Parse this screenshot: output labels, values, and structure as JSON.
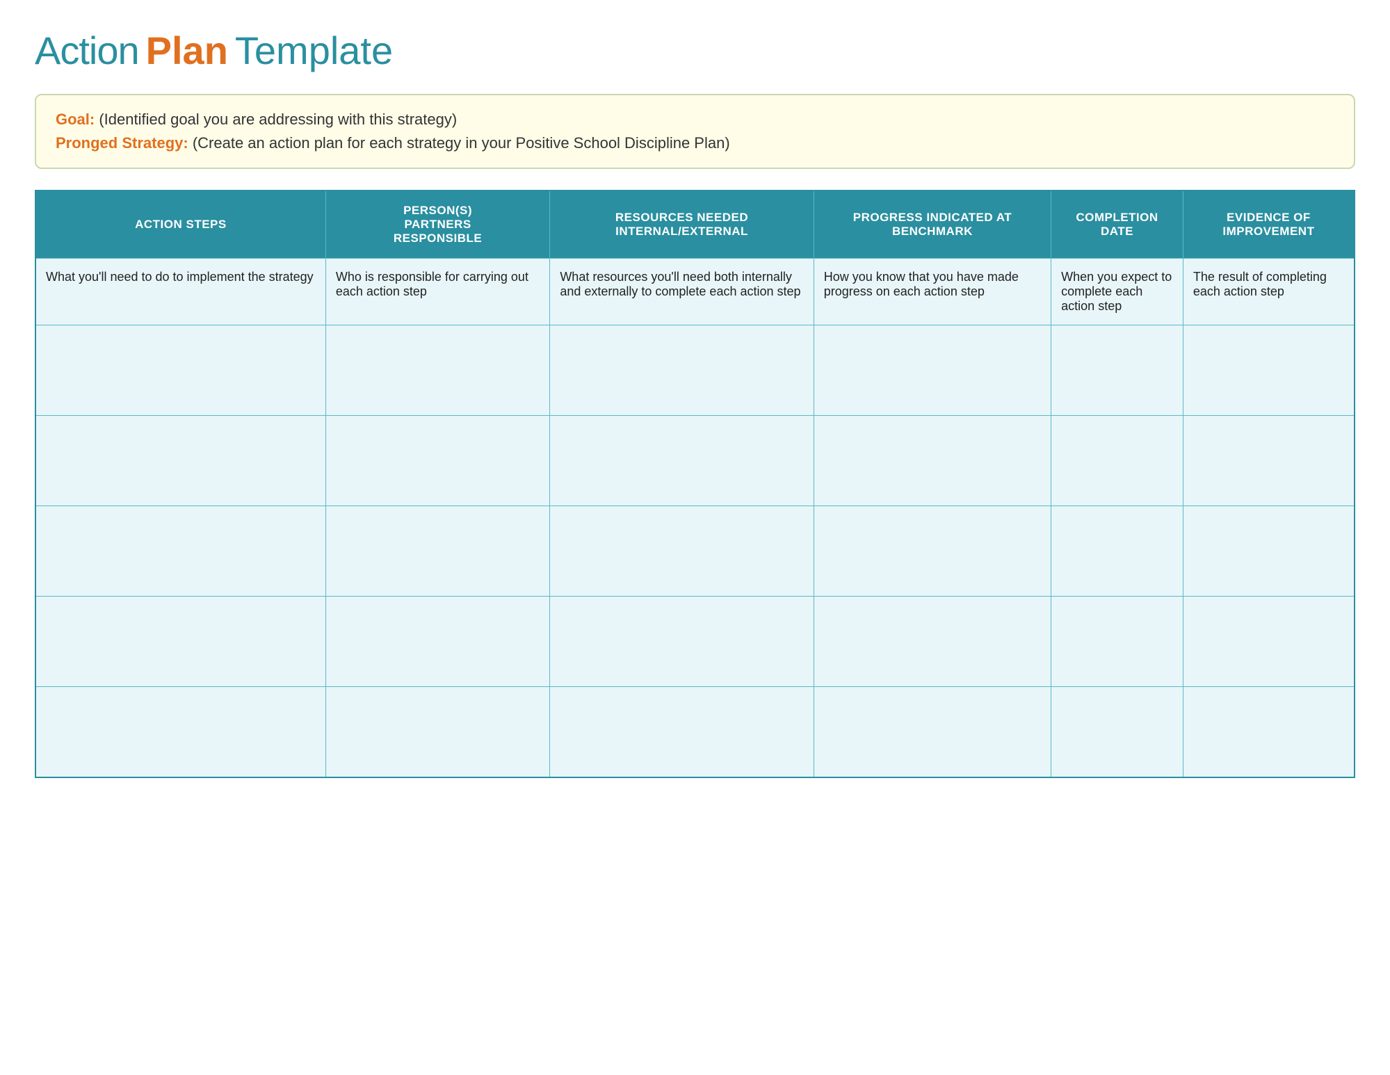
{
  "title": {
    "action": "Action",
    "plan": "Plan",
    "template": "Template"
  },
  "goal_box": {
    "goal_label": "Goal:",
    "goal_text": "(Identified goal you are addressing with this strategy)",
    "strategy_label": "Pronged Strategy:",
    "strategy_text": " (Create an action plan for each strategy in your Positive School Discipline Plan)"
  },
  "table": {
    "headers": [
      {
        "id": "action-steps",
        "lines": [
          "ACTION STEPS"
        ]
      },
      {
        "id": "person-responsible",
        "lines": [
          "PERSON(S)",
          "PARTNERS",
          "RESPONSIBLE"
        ]
      },
      {
        "id": "resources-needed",
        "lines": [
          "RESOURCES NEEDED",
          "INTERNAL/EXTERNAL"
        ]
      },
      {
        "id": "progress-benchmark",
        "lines": [
          "PROGRESS INDICATED AT",
          "BENCHMARK"
        ]
      },
      {
        "id": "completion-date",
        "lines": [
          "COMPLETION",
          "DATE"
        ]
      },
      {
        "id": "evidence-improvement",
        "lines": [
          "EVIDENCE OF",
          "IMPROVEMENT"
        ]
      }
    ],
    "description_row": {
      "action_steps": "What you'll need to do to implement the strategy",
      "person_responsible": "Who is responsible for carrying out each action step",
      "resources_needed": "What resources you'll need both internally and externally to complete each action step",
      "progress_benchmark": "How you know that you have made progress on each action step",
      "completion_date": "When you expect to complete each action step",
      "evidence_improvement": "The result of completing each action step"
    },
    "empty_rows": 5
  }
}
